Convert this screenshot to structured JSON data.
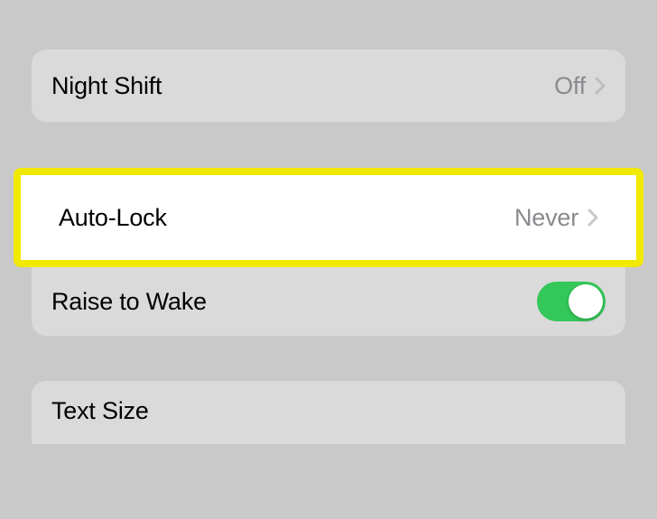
{
  "group1": {
    "night_shift": {
      "label": "Night Shift",
      "value": "Off"
    }
  },
  "group2": {
    "auto_lock": {
      "label": "Auto-Lock",
      "value": "Never"
    },
    "raise_to_wake": {
      "label": "Raise to Wake",
      "enabled": true
    }
  },
  "group3": {
    "text_size": {
      "label": "Text Size"
    }
  },
  "colors": {
    "toggle_on": "#34c759",
    "highlight": "#f2e900"
  }
}
